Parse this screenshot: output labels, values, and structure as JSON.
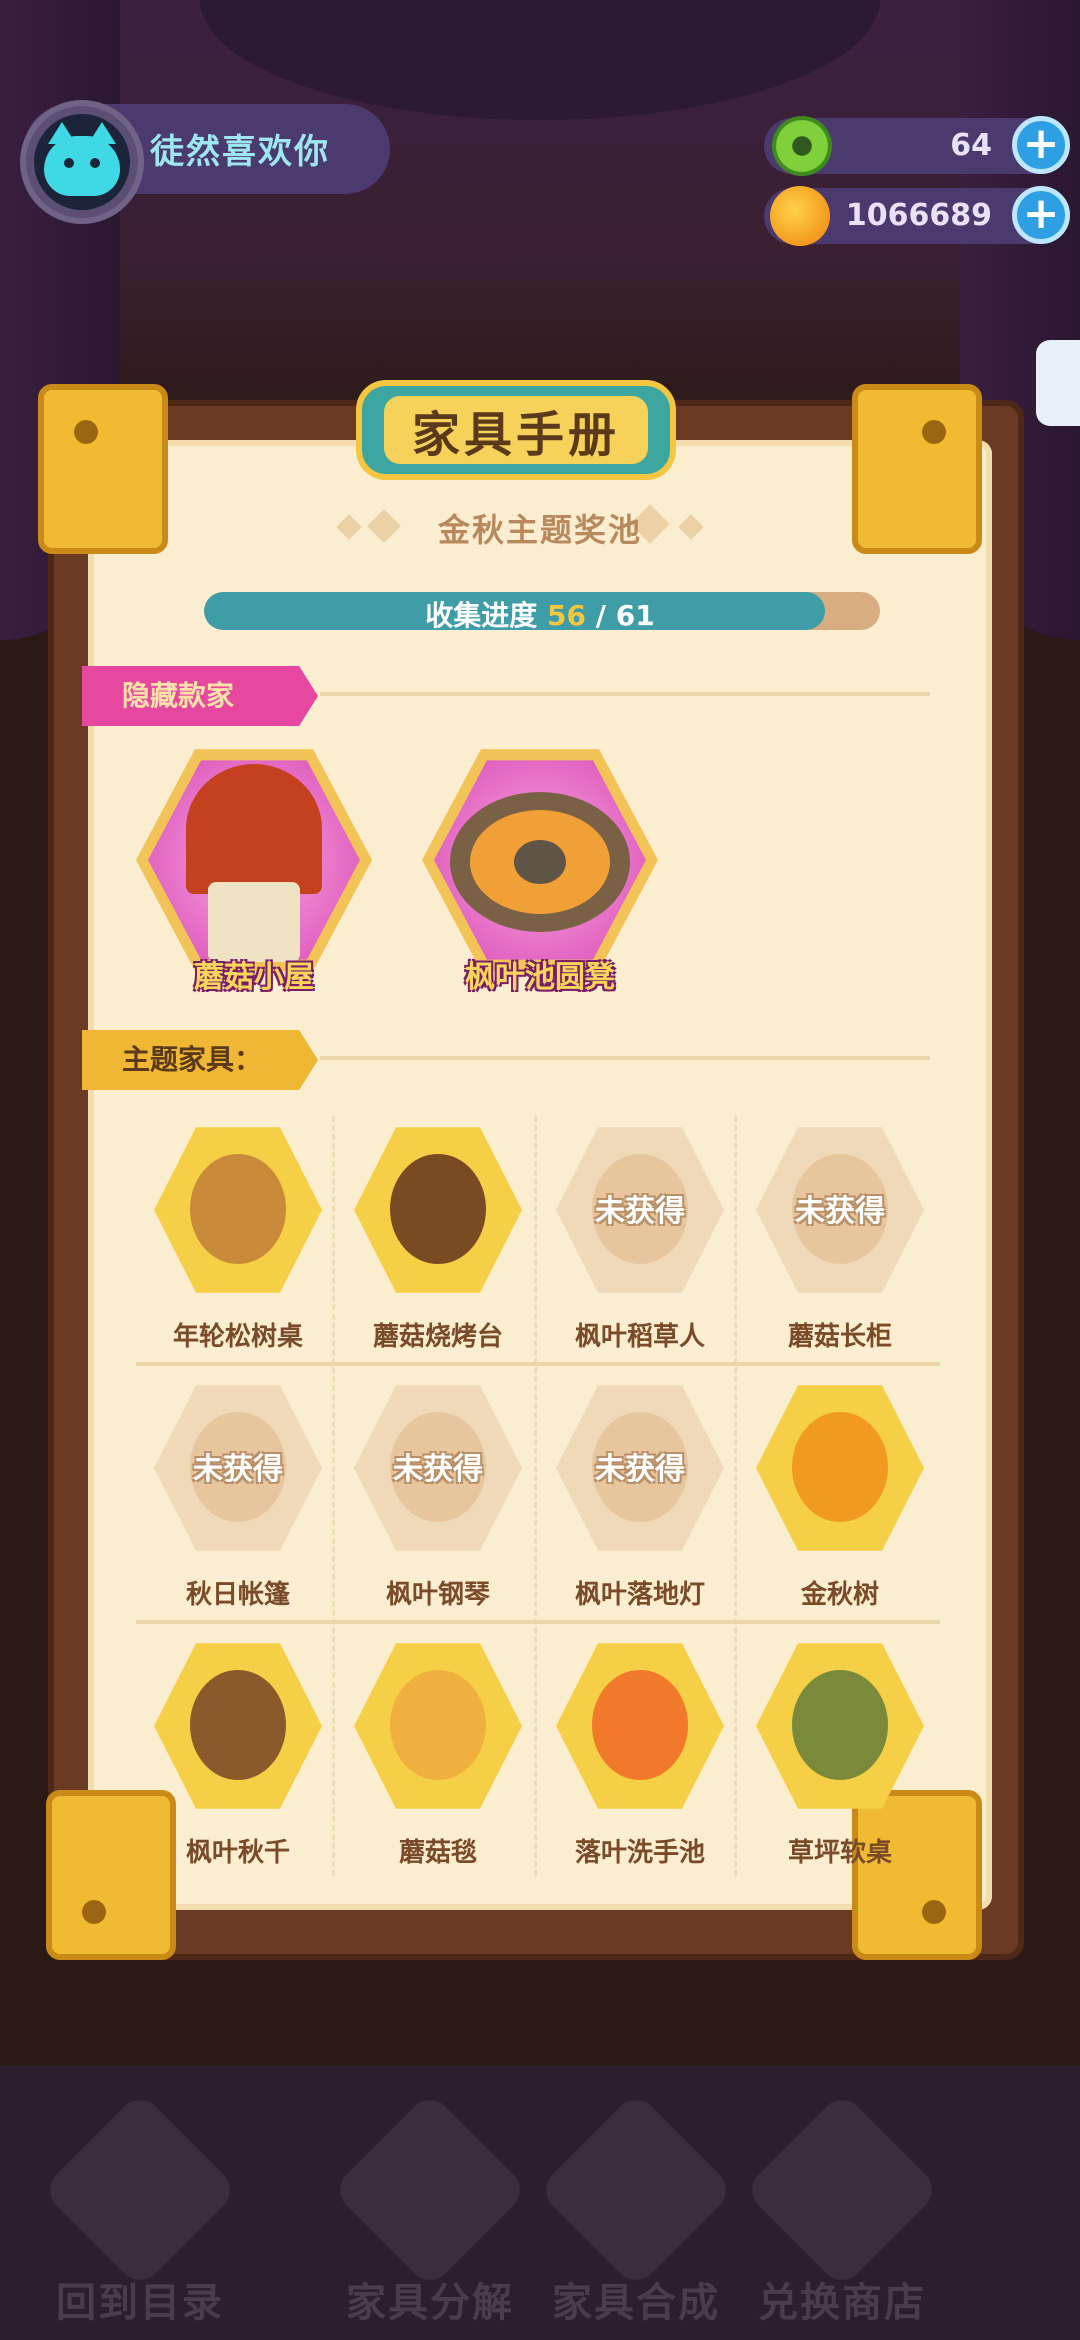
{
  "header": {
    "player_name": "徒然喜欢你",
    "currency": [
      {
        "name": "green-gem",
        "value": "64"
      },
      {
        "name": "gold-planet",
        "value": "1066689"
      }
    ]
  },
  "book": {
    "title": "家具手册",
    "pool_title": "金秋主题奖池",
    "progress": {
      "label": "收集进度",
      "current": "56",
      "separator": "/",
      "total": "61",
      "fraction": 0.918
    }
  },
  "hidden_section": {
    "label": "隐藏款家具：",
    "items": [
      {
        "name": "蘑菇小屋",
        "icon": "mushroom-house-icon"
      },
      {
        "name": "枫叶池圆凳",
        "icon": "maple-pool-stool-icon"
      }
    ]
  },
  "theme_section": {
    "label": "主题家具：",
    "locked_text": "未获得",
    "items": [
      {
        "name": "年轮松树桌",
        "owned": true,
        "icon": "tree-ring-table-icon"
      },
      {
        "name": "蘑菇烧烤台",
        "owned": true,
        "icon": "mushroom-grill-icon"
      },
      {
        "name": "枫叶稻草人",
        "owned": false,
        "icon": "scarecrow-icon"
      },
      {
        "name": "蘑菇长柜",
        "owned": false,
        "icon": "mushroom-cabinet-icon"
      },
      {
        "name": "秋日帐篷",
        "owned": false,
        "icon": "tent-icon"
      },
      {
        "name": "枫叶钢琴",
        "owned": false,
        "icon": "piano-icon"
      },
      {
        "name": "枫叶落地灯",
        "owned": false,
        "icon": "floor-lamp-icon"
      },
      {
        "name": "金秋树",
        "owned": true,
        "icon": "golden-tree-icon"
      },
      {
        "name": "枫叶秋千",
        "owned": true,
        "icon": "swing-icon"
      },
      {
        "name": "蘑菇毯",
        "owned": true,
        "icon": "mushroom-rug-icon"
      },
      {
        "name": "落叶洗手池",
        "owned": true,
        "icon": "sink-icon"
      },
      {
        "name": "草坪软桌",
        "owned": true,
        "icon": "lawn-table-icon"
      }
    ]
  },
  "bottom_nav": [
    {
      "label": "回到目录",
      "icon": "back-book-icon"
    },
    {
      "label": "家具分解",
      "icon": "puzzle-icon"
    },
    {
      "label": "家具合成",
      "icon": "hammer-icon"
    },
    {
      "label": "兑换商店",
      "icon": "gift-icon"
    }
  ],
  "colors": {
    "accent_teal": "#3ea6a0",
    "gold": "#f5cf45",
    "hidden_pink": "#e6489f",
    "paper": "#fbedd0",
    "frame": "#6b3a22"
  }
}
